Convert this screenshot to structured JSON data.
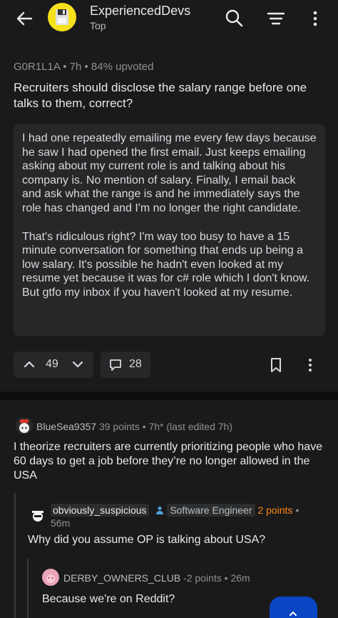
{
  "header": {
    "subreddit": "ExperiencedDevs",
    "sort": "Top",
    "icons": [
      "back-arrow-icon",
      "search-icon",
      "sort-icon",
      "more-vertical-icon"
    ]
  },
  "post": {
    "author": "G0R1L1A",
    "time": "7h",
    "upvoted": "84% upvoted",
    "title": "Recruiters should disclose the salary range before one talks to them, correct?",
    "body_p1": "I had one repeatedly emailing me every few days because he saw I had opened the first email. Just keeps emailing asking about my current role is and talking about his company is. No mention of salary. Finally, I email back and ask what the range is and he immediately says the role has changed and I'm no longer the right candidate.",
    "body_p2": "That's ridiculous right? I'm way too busy to have a 15 minute conversation for something that ends up being a low salary. It's possible he hadn't even looked at my resume yet because it was for c# role which I don't know. But gtfo my inbox if you haven't looked at my resume.",
    "votes": "49",
    "comments": "28"
  },
  "comments": [
    {
      "user": "BlueSea9357",
      "points": "39 points",
      "time": "7h* (last edited 7h)",
      "body": "I theorize recruiters are currently prioritizing people who have 60 days to get a job before they’re no longer allowed in the USA"
    },
    {
      "user": "obviously_suspicious",
      "flair": "Software Engineer",
      "points": "2 points",
      "time": "56m",
      "body": "Why did you assume OP is talking about USA?"
    },
    {
      "user": "DERBY_OWNERS_CLUB",
      "points": "-2 points",
      "time": "26m",
      "body": "Because we're on Reddit?"
    }
  ],
  "colors": {
    "background": "#1a1a1b",
    "card": "#272729",
    "accent_orange": "#ff8717",
    "fab_blue": "#0a45c4",
    "subreddit_icon": "#f7e11b"
  }
}
